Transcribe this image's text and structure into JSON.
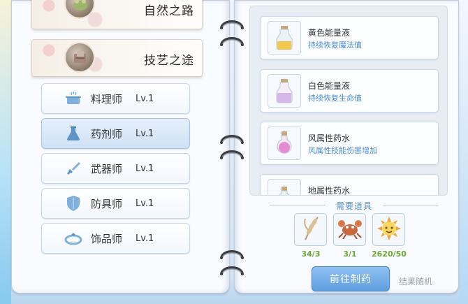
{
  "left_page": {
    "illustrated_cards": [
      {
        "title": "自然之路"
      },
      {
        "title": "技艺之途"
      }
    ],
    "professions": [
      {
        "name": "料理师",
        "level": "Lv.1",
        "icon": "cooking-pot-icon",
        "active": false
      },
      {
        "name": "药剂师",
        "level": "Lv.1",
        "icon": "flask-icon",
        "active": true
      },
      {
        "name": "武器师",
        "level": "Lv.1",
        "icon": "sword-icon",
        "active": false
      },
      {
        "name": "防具师",
        "level": "Lv.1",
        "icon": "shield-icon",
        "active": false
      },
      {
        "name": "饰品师",
        "level": "Lv.1",
        "icon": "ring-icon",
        "active": false
      }
    ]
  },
  "right_page": {
    "recipes": [
      {
        "name": "黄色能量液",
        "desc": "持续恢复魔法值",
        "icon": "yellow-potion-icon",
        "color": "#f2c94c"
      },
      {
        "name": "白色能量液",
        "desc": "持续恢复生命值",
        "icon": "white-potion-icon",
        "color": "#d7b6e8"
      },
      {
        "name": "风属性药水",
        "desc": "风属性技能伤害增加",
        "icon": "wind-potion-icon",
        "color": "#e58bd6"
      },
      {
        "name": "地属性药水",
        "desc": "",
        "icon": "earth-potion-icon",
        "color": "#7fc9a0"
      }
    ],
    "required_title": "需要道具",
    "required_items": [
      {
        "icon": "wheat-icon",
        "count": "34/3"
      },
      {
        "icon": "crab-icon",
        "count": "3/1"
      },
      {
        "icon": "sun-icon",
        "count": "2620/50"
      }
    ],
    "go_button": "前往制药",
    "random_note": "结果随机"
  },
  "colors": {
    "accent_blue": "#5f9ee0",
    "desc_blue": "#4a8ad0",
    "count_green": "#6aa832"
  }
}
